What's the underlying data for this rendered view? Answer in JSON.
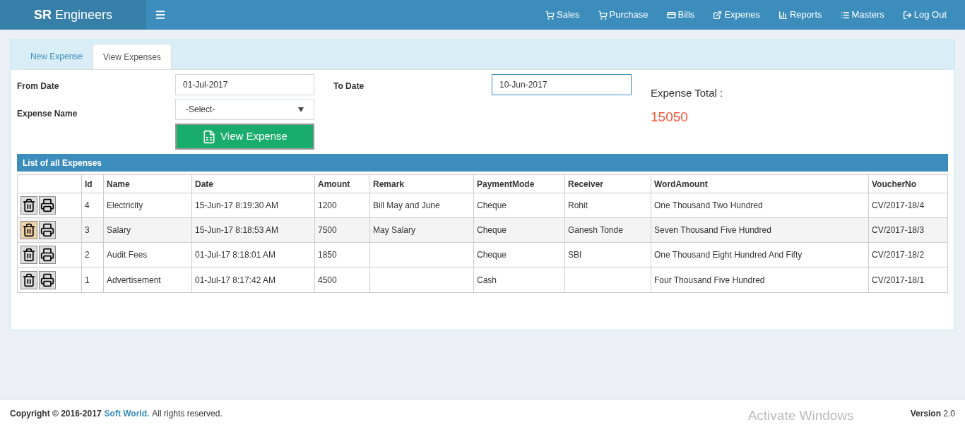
{
  "brand": {
    "bold": "SR",
    "rest": "Engineers"
  },
  "nav": [
    {
      "kind": "cart",
      "label": "Sales"
    },
    {
      "kind": "cart",
      "label": "Purchase"
    },
    {
      "kind": "card",
      "label": "Bills"
    },
    {
      "kind": "external",
      "label": "Expenes"
    },
    {
      "kind": "chart",
      "label": "Reports"
    },
    {
      "kind": "list",
      "label": "Masters"
    },
    {
      "kind": "logout",
      "label": "Log Out"
    }
  ],
  "tabs": [
    {
      "label": "New Expense",
      "selected": false
    },
    {
      "label": "View Expenses",
      "selected": true
    }
  ],
  "form": {
    "from_label": "From Date",
    "from_value": "01-Jul-2017",
    "to_label": "To Date",
    "to_value": "10-Jun-2017",
    "to_focused": true,
    "name_label": "Expense Name",
    "name_value": "-Select-",
    "button": "View Expense"
  },
  "total": {
    "label": "Expense Total :",
    "value": "15050"
  },
  "table": {
    "title": "List of all Expenses",
    "columns": [
      "",
      "Id",
      "Name",
      "Date",
      "Amount",
      "Remark",
      "PaymentMode",
      "Receiver",
      "WordAmount",
      "VoucherNo"
    ],
    "rows": [
      {
        "selected": false,
        "cells": [
          "",
          "4",
          "Electricity",
          "15-Jun-17 8:19:30 AM",
          "1200",
          "Bill May and June",
          "Cheque",
          "Rohit",
          "One Thousand Two Hundred",
          "CV/2017-18/4"
        ]
      },
      {
        "selected": true,
        "cells": [
          "",
          "3",
          "Salary",
          "15-Jun-17 8:18:53 AM",
          "7500",
          "May Salary",
          "Cheque",
          "Ganesh Tonde",
          "Seven Thousand Five Hundred",
          "CV/2017-18/3"
        ]
      },
      {
        "selected": false,
        "cells": [
          "",
          "2",
          "Audit Fees",
          "01-Jul-17 8:18:01 AM",
          "1850",
          "",
          "Cheque",
          "SBI",
          "One Thousand Eight Hundred And Fifty",
          "CV/2017-18/2"
        ]
      },
      {
        "selected": false,
        "cells": [
          "",
          "1",
          "Advertisement",
          "01-Jul-17 8:17:42 AM",
          "4500",
          "",
          "Cash",
          "",
          "Four Thousand Five Hundred",
          "CV/2017-18/1"
        ]
      }
    ]
  },
  "footer": {
    "copyright": "Copyright © 2016-2017",
    "link": "Soft World.",
    "rights": "All rights reserved.",
    "activation": "Activate Windows",
    "version": "**Version** 2.0"
  }
}
